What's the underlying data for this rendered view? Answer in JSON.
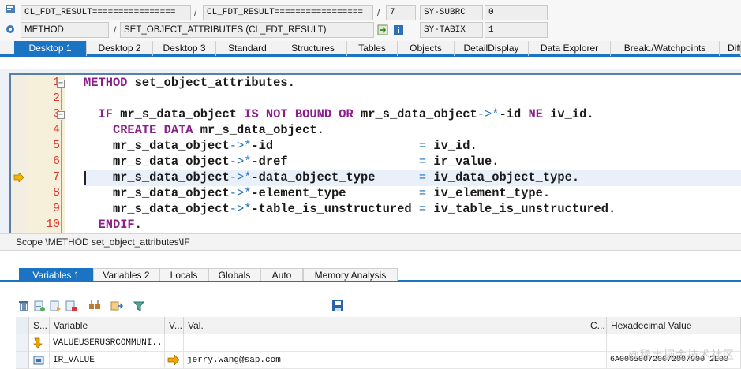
{
  "header": {
    "row1": {
      "program": "CL_FDT_RESULT================",
      "include": "CL_FDT_RESULT=================",
      "line": "7",
      "sysfield_name": "SY-SUBRC",
      "sysfield_value": "0"
    },
    "row2": {
      "event_type": "METHOD",
      "event": "SET_OBJECT_ATTRIBUTES (CL_FDT_RESULT)",
      "sysfield_name": "SY-TABIX",
      "sysfield_value": "1"
    }
  },
  "desktop_tabs": [
    "Desktop 1",
    "Desktop 2",
    "Desktop 3",
    "Standard",
    "Structures",
    "Tables",
    "Objects",
    "DetailDisplay",
    "Data Explorer",
    "Break./Watchpoints",
    "Diff"
  ],
  "editor": {
    "line_numbers": [
      "1",
      "2",
      "3",
      "4",
      "5",
      "6",
      "7",
      "8",
      "9",
      "10"
    ],
    "current_line": "7",
    "lines": [
      [
        [
          "kw",
          "METHOD"
        ],
        [
          "t",
          " set_object_attributes."
        ]
      ],
      [],
      [
        [
          "t",
          "  "
        ],
        [
          "kw",
          "IF"
        ],
        [
          "t",
          " mr_s_data_object "
        ],
        [
          "kw",
          "IS NOT BOUND OR"
        ],
        [
          "t",
          " mr_s_data_object"
        ],
        [
          "op",
          "->*"
        ],
        [
          "t",
          "-id "
        ],
        [
          "kw",
          "NE"
        ],
        [
          "t",
          " iv_id."
        ]
      ],
      [
        [
          "t",
          "    "
        ],
        [
          "kw",
          "CREATE DATA"
        ],
        [
          "t",
          " mr_s_data_object."
        ]
      ],
      [
        [
          "t",
          "    mr_s_data_object"
        ],
        [
          "op",
          "->*"
        ],
        [
          "t",
          "-id                    "
        ],
        [
          "op",
          "="
        ],
        [
          "t",
          " iv_id."
        ]
      ],
      [
        [
          "t",
          "    mr_s_data_object"
        ],
        [
          "op",
          "->*"
        ],
        [
          "t",
          "-dref                  "
        ],
        [
          "op",
          "="
        ],
        [
          "t",
          " ir_value."
        ]
      ],
      [
        [
          "t",
          "    mr_s_data_object"
        ],
        [
          "op",
          "->*"
        ],
        [
          "t",
          "-data_object_type      "
        ],
        [
          "op",
          "="
        ],
        [
          "t",
          " iv_data_object_type."
        ]
      ],
      [
        [
          "t",
          "    mr_s_data_object"
        ],
        [
          "op",
          "->*"
        ],
        [
          "t",
          "-element_type          "
        ],
        [
          "op",
          "="
        ],
        [
          "t",
          " iv_element_type."
        ]
      ],
      [
        [
          "t",
          "    mr_s_data_object"
        ],
        [
          "op",
          "->*"
        ],
        [
          "t",
          "-table_is_unstructured "
        ],
        [
          "op",
          "="
        ],
        [
          "t",
          " iv_table_is_unstructured."
        ]
      ],
      [
        [
          "t",
          "  "
        ],
        [
          "kw",
          "ENDIF"
        ],
        [
          "t",
          "."
        ]
      ]
    ]
  },
  "scope": "Scope \\METHOD set_object_attributes\\IF",
  "variable_tabs": [
    "Variables 1",
    "Variables 2",
    "Locals",
    "Globals",
    "Auto",
    "Memory Analysis"
  ],
  "grid": {
    "headers": [
      "S...",
      "Variable",
      "V...",
      "Val.",
      "C...",
      "Hexadecimal Value"
    ],
    "rows": [
      {
        "variable": "VALUEUSERUSRCOMMUNI...",
        "value": "",
        "hex": ""
      },
      {
        "variable": "IR_VALUE",
        "value": "jerry.wang@sap.com",
        "hex": "6A006500720072007900 2E00"
      }
    ]
  },
  "watermark": "@稀土掘金技术社区",
  "colors": {
    "accent": "#1b73c4",
    "keyword": "#8a1e8a",
    "operator": "#1f6fbf",
    "line_number": "#d7362b"
  },
  "icons": [
    "program-icon",
    "method-icon",
    "navigate-icon",
    "info-icon",
    "delete-icon",
    "toolbar-icon",
    "save-icon",
    "breakpoint-arrow-icon",
    "change-value-icon"
  ]
}
